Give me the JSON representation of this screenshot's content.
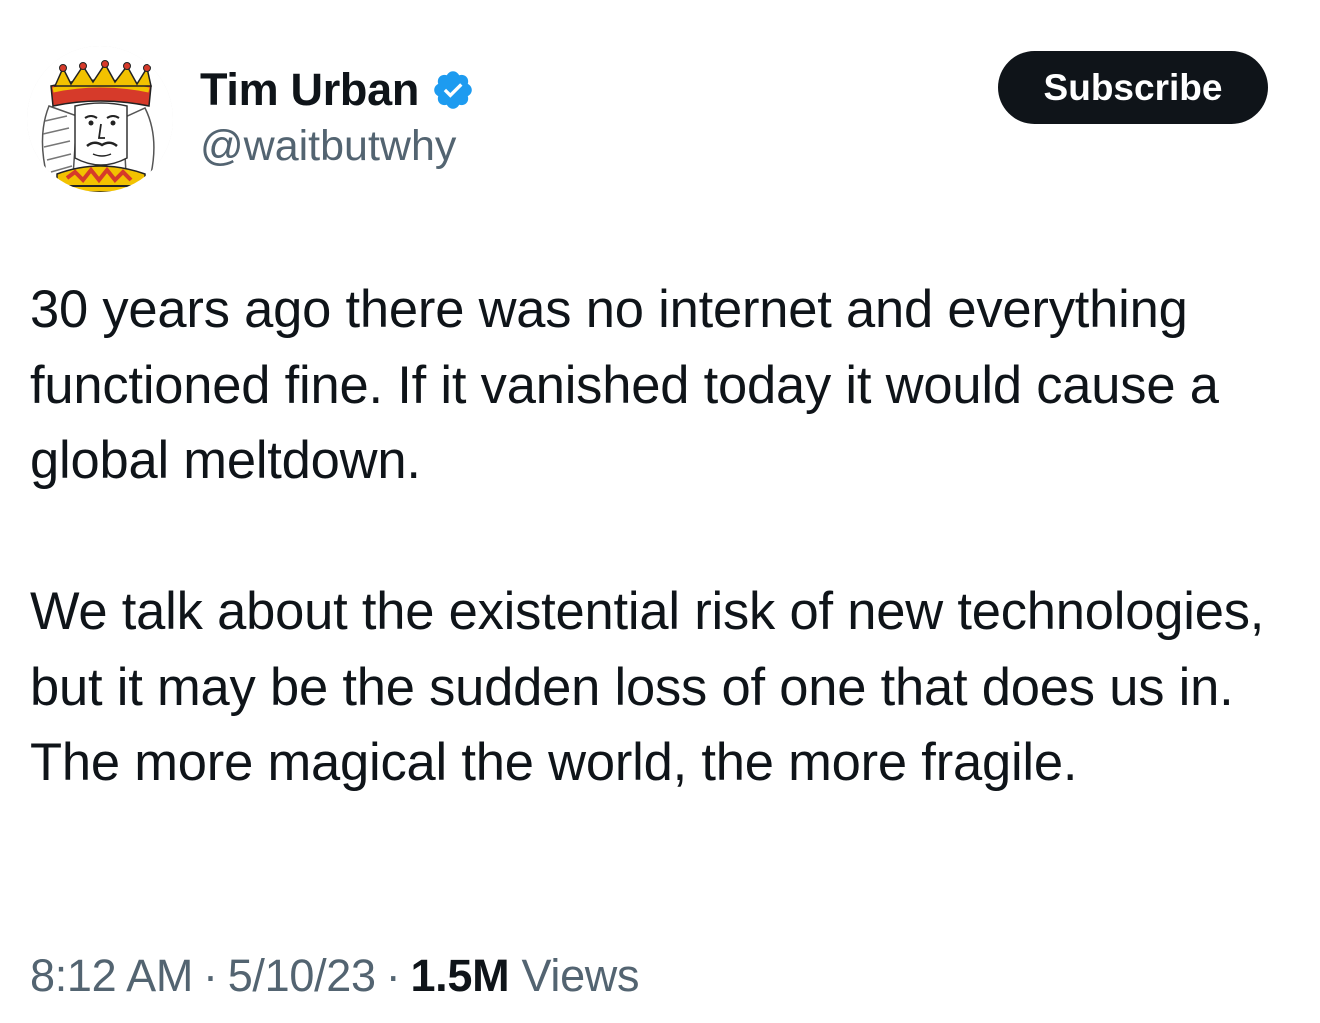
{
  "author": {
    "display_name": "Tim Urban",
    "handle": "@waitbutwhy",
    "verified": true,
    "avatar_icon": "king-playing-card-avatar"
  },
  "header": {
    "subscribe_label": "Subscribe"
  },
  "tweet": {
    "paragraphs": [
      "30 years ago there was no internet and everything functioned fine. If it vanished today it would cause a global meltdown.",
      "We talk about the existential risk of new technologies, but it may be the sudden loss of one that does us in. The more magical the world, the more fragile."
    ]
  },
  "meta": {
    "time": "8:12 AM",
    "separator": "·",
    "date": "5/10/23",
    "views_count": "1.5M",
    "views_label": "Views"
  },
  "colors": {
    "text_primary": "#0f1419",
    "text_secondary": "#536471",
    "verified_blue": "#1d9bf0",
    "button_bg": "#0f1419",
    "button_text": "#ffffff"
  }
}
